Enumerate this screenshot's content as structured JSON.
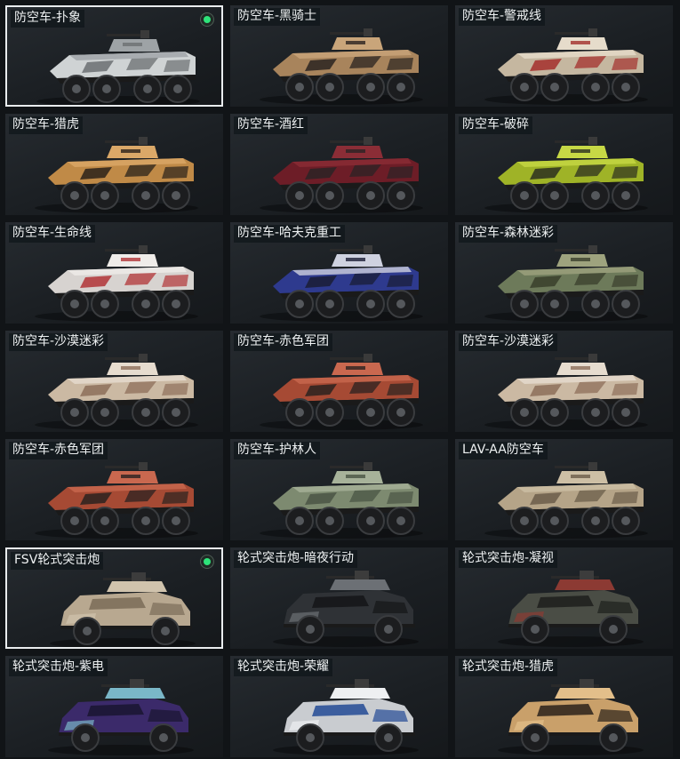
{
  "items": [
    {
      "label": "防空车-扑象",
      "selected": true,
      "equipped": true,
      "type": "aa",
      "c1": "#cfd3d4",
      "c2": "#6b6f72",
      "c3": "#9ea3a6"
    },
    {
      "label": "防空车-黑骑士",
      "selected": false,
      "equipped": false,
      "type": "aa",
      "c1": "#a8845c",
      "c2": "#2a2320",
      "c3": "#c9a57a"
    },
    {
      "label": "防空车-警戒线",
      "selected": false,
      "equipped": false,
      "type": "aa",
      "c1": "#c5b7a0",
      "c2": "#a32f2c",
      "c3": "#e6dccb"
    },
    {
      "label": "防空车-猎虎",
      "selected": false,
      "equipped": false,
      "type": "aa",
      "c1": "#c08a47",
      "c2": "#2a211a",
      "c3": "#dba868"
    },
    {
      "label": "防空车-酒红",
      "selected": false,
      "equipped": false,
      "type": "aa",
      "c1": "#6d1d27",
      "c2": "#2b2326",
      "c3": "#8b2d36"
    },
    {
      "label": "防空车-破碎",
      "selected": false,
      "equipped": false,
      "type": "aa",
      "c1": "#9fb327",
      "c2": "#2c2f20",
      "c3": "#c7d845"
    },
    {
      "label": "防空车-生命线",
      "selected": false,
      "equipped": false,
      "type": "aa",
      "c1": "#d7d3d0",
      "c2": "#b23437",
      "c3": "#efece9"
    },
    {
      "label": "防空车-哈夫克重工",
      "selected": false,
      "equipped": false,
      "type": "aa",
      "c1": "#2e3a8e",
      "c2": "#1a1d35",
      "c3": "#cfd2e0"
    },
    {
      "label": "防空车-森林迷彩",
      "selected": false,
      "equipped": false,
      "type": "aa",
      "c1": "#6d7a5a",
      "c2": "#3a3f2c",
      "c3": "#9ea37e"
    },
    {
      "label": "防空车-沙漠迷彩",
      "selected": false,
      "equipped": false,
      "type": "aa",
      "c1": "#cbb9a3",
      "c2": "#8d6f5a",
      "c3": "#e6dccf"
    },
    {
      "label": "防空车-赤色军团",
      "selected": false,
      "equipped": false,
      "type": "aa",
      "c1": "#a64a34",
      "c2": "#2a2220",
      "c3": "#c9684f"
    },
    {
      "label": "防空车-沙漠迷彩",
      "selected": false,
      "equipped": false,
      "type": "aa",
      "c1": "#cbb9a3",
      "c2": "#8d6f5a",
      "c3": "#e6dccf"
    },
    {
      "label": "防空车-赤色军团",
      "selected": false,
      "equipped": false,
      "type": "aa",
      "c1": "#a64a34",
      "c2": "#2a2220",
      "c3": "#c9684f"
    },
    {
      "label": "防空车-护林人",
      "selected": false,
      "equipped": false,
      "type": "aa",
      "c1": "#7d8a70",
      "c2": "#4a5444",
      "c3": "#a7b29a"
    },
    {
      "label": "LAV-AA防空车",
      "selected": false,
      "equipped": false,
      "type": "aa",
      "c1": "#b5a488",
      "c2": "#6b5d4a",
      "c3": "#cdbfa5"
    },
    {
      "label": "FSV轮式突击炮",
      "selected": true,
      "equipped": true,
      "type": "fsv",
      "c1": "#b8a890",
      "c2": "#7a6c58",
      "c3": "#d0c3ad"
    },
    {
      "label": "轮式突击炮-暗夜行动",
      "selected": false,
      "equipped": false,
      "type": "fsv",
      "c1": "#2f3236",
      "c2": "#141517",
      "c3": "#6c7075"
    },
    {
      "label": "轮式突击炮-凝视",
      "selected": false,
      "equipped": false,
      "type": "fsv",
      "c1": "#4a4d45",
      "c2": "#1d1f1c",
      "c3": "#8c3a33"
    },
    {
      "label": "轮式突击炮-紫电",
      "selected": false,
      "equipped": false,
      "type": "fsv",
      "c1": "#3b2a6a",
      "c2": "#1a1530",
      "c3": "#7ab7c8"
    },
    {
      "label": "轮式突击炮-荣耀",
      "selected": false,
      "equipped": false,
      "type": "fsv",
      "c1": "#c9ccd0",
      "c2": "#234a95",
      "c3": "#eef0f2"
    },
    {
      "label": "轮式突击炮-猎虎",
      "selected": false,
      "equipped": false,
      "type": "fsv",
      "c1": "#c9a06a",
      "c2": "#2a211a",
      "c3": "#e3bf8a"
    }
  ]
}
